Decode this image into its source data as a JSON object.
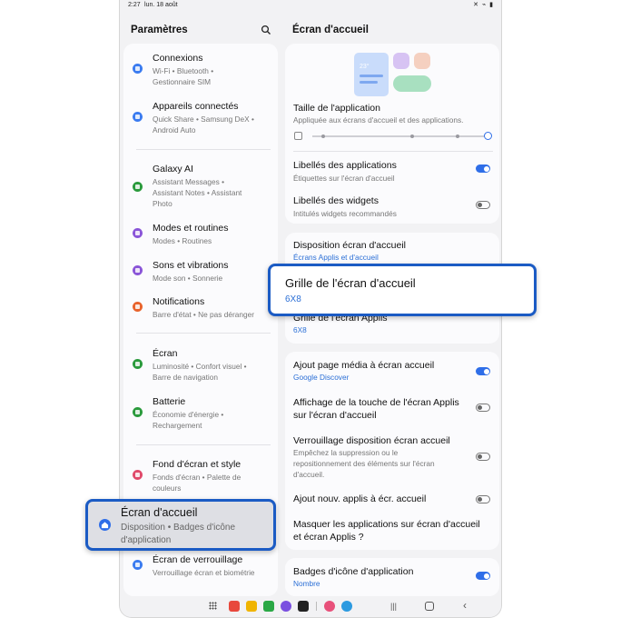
{
  "status": {
    "time": "2:27",
    "date": "lun. 18 août",
    "icons": "✕ ⌁ ▮"
  },
  "left": {
    "title": "Paramètres",
    "items": [
      {
        "title": "Connexions",
        "sub": "Wi-Fi  •  Bluetooth  •\nGestionnaire SIM",
        "color": "#3a7bf0"
      },
      {
        "title": "Appareils connectés",
        "sub": "Quick Share  •  Samsung DeX  •\nAndroid Auto",
        "color": "#3a7bf0"
      },
      {
        "title": "Galaxy AI",
        "sub": "Assistant Messages  •\nAssistant Notes  •  Assistant\nPhoto",
        "color": "#2a9a3c"
      },
      {
        "title": "Modes et routines",
        "sub": "Modes  •  Routines",
        "color": "#8a55d8"
      },
      {
        "title": "Sons et vibrations",
        "sub": "Mode son  •  Sonnerie",
        "color": "#8a55d8"
      },
      {
        "title": "Notifications",
        "sub": "Barre d'état  •  Ne pas déranger",
        "color": "#e8632c"
      },
      {
        "title": "Écran",
        "sub": "Luminosité  •  Confort visuel  •\nBarre de navigation",
        "color": "#2a9a3c"
      },
      {
        "title": "Batterie",
        "sub": "Économie d'énergie  •\nRechargement",
        "color": "#2a9a3c"
      },
      {
        "title": "Fond d'écran et style",
        "sub": "Fonds d'écran  •  Palette de\ncouleurs",
        "color": "#e04a6a"
      },
      {
        "title": "Écran de verrouillage",
        "sub": "Verrouillage écran et biométrie",
        "color": "#3a7bf0"
      }
    ],
    "selected": {
      "title": "Écran d'accueil",
      "sub": "Disposition  •  Badges d'icône\nd'application"
    }
  },
  "right": {
    "title": "Écran d'accueil",
    "preview_label": "23°",
    "app_size": {
      "title": "Taille de l'application",
      "sub": "Appliquée aux écrans d'accueil et des applications."
    },
    "app_labels": {
      "title": "Libellés des applications",
      "sub": "Étiquettes sur l'écran d'accueil",
      "on": true
    },
    "widget_labels": {
      "title": "Libellés des widgets",
      "sub": "Intitulés widgets recommandés",
      "on": false
    },
    "layout": {
      "title": "Disposition écran d'accueil",
      "value": "Écrans Applis et d'accueil"
    },
    "home_grid": {
      "title": "Grille de l'écran d'accueil",
      "value": "6X8"
    },
    "apps_grid": {
      "title": "Grille de l'écran Applis",
      "value": "6X8"
    },
    "media_page": {
      "title": "Ajout page média à écran accueil",
      "value": "Google Discover",
      "on": true
    },
    "apps_button": {
      "title": "Affichage de la touche de l'écran Applis\nsur l'écran d'accueil",
      "on": false
    },
    "lock_layout": {
      "title": "Verrouillage disposition écran accueil",
      "sub": "Empêchez la suppression ou le\nrepositionnement des éléments sur l'écran\nd'accueil.",
      "on": false
    },
    "add_new_apps": {
      "title": "Ajout nouv. applis à écr. accueil",
      "on": false
    },
    "hide_apps": {
      "title": "Masquer les applications sur écran d'accueil\net écran Applis ?"
    },
    "badges": {
      "title": "Badges d'icône d'application",
      "value": "Nombre",
      "on": true
    }
  },
  "callouts": {
    "grid": {
      "title": "Grille de l'écran d'accueil",
      "value": "6X8"
    },
    "home": {
      "title": "Écran d'accueil",
      "sub": "Disposition  •  Badges d'icône\nd'application"
    }
  },
  "nav_apps": [
    "#e8483c",
    "#f0b400",
    "#2aa845",
    "#7a4fe0",
    "#222222",
    "#e8507a",
    "#2c9ae0"
  ]
}
